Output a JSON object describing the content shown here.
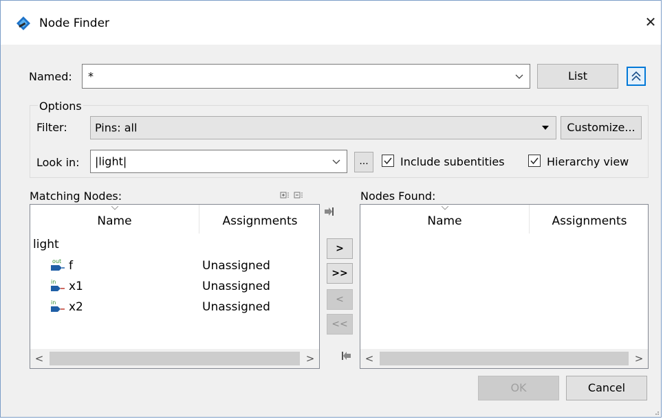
{
  "window": {
    "title": "Node Finder",
    "close_glyph": "✕"
  },
  "named": {
    "label": "Named:",
    "value": "*",
    "list_button": "List"
  },
  "options": {
    "group_title": "Options",
    "filter_label": "Filter:",
    "filter_value": "Pins: all",
    "customize_button": "Customize...",
    "lookin_label": "Look in:",
    "lookin_value": "|light|",
    "browse_button": "...",
    "include_subentities": {
      "label": "Include subentities",
      "checked": true
    },
    "hierarchy_view": {
      "label": "Hierarchy view",
      "checked": true
    }
  },
  "matching": {
    "label": "Matching Nodes:",
    "columns": [
      "Name",
      "Assignments"
    ],
    "root": "light",
    "rows": [
      {
        "direction": "out",
        "name": "f",
        "assignment": "Unassigned"
      },
      {
        "direction": "in",
        "name": "x1",
        "assignment": "Unassigned"
      },
      {
        "direction": "in",
        "name": "x2",
        "assignment": "Unassigned"
      }
    ]
  },
  "found": {
    "label": "Nodes Found:",
    "columns": [
      "Name",
      "Assignments"
    ]
  },
  "move_buttons": {
    "add": ">",
    "add_all": ">>",
    "remove": "<",
    "remove_all": "<<"
  },
  "footer": {
    "ok": "OK",
    "cancel": "Cancel"
  },
  "colors": {
    "accent": "#0078d7",
    "pin_blue": "#1f5fa6",
    "pin_green": "#2e8b2e"
  },
  "scroll": {
    "left": "<",
    "right": ">"
  }
}
